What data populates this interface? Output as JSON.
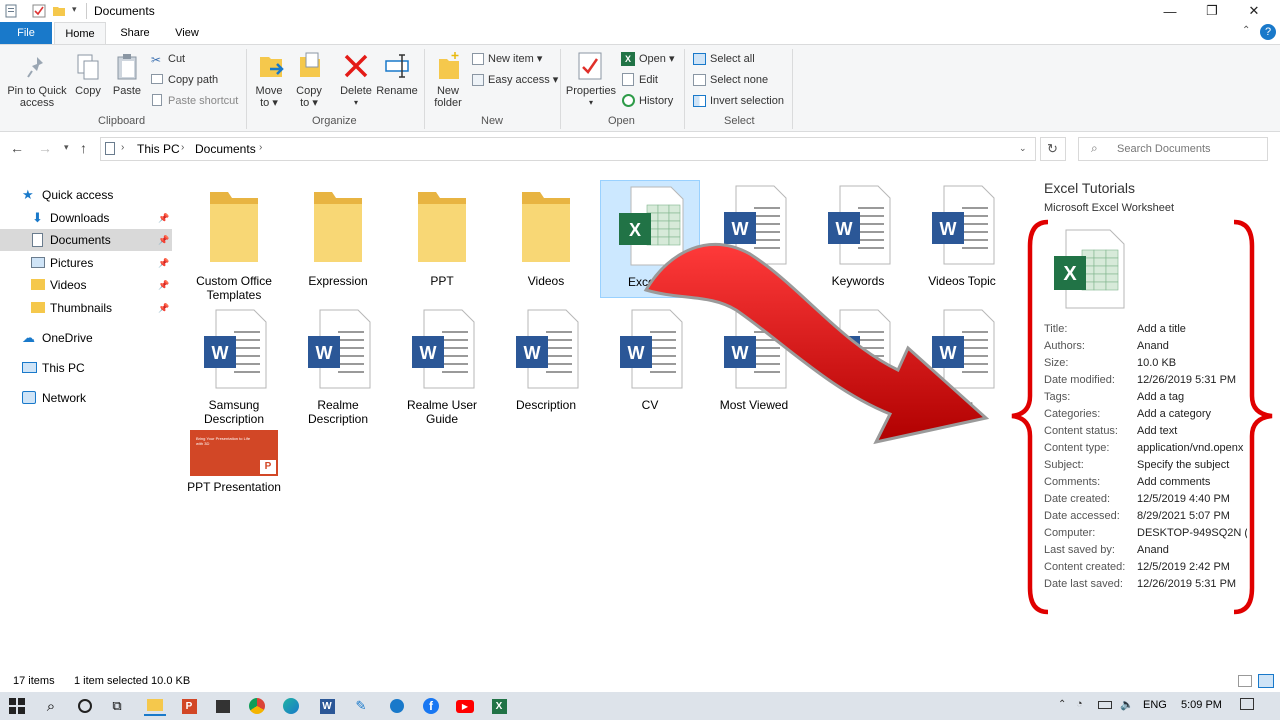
{
  "window": {
    "title": "Documents",
    "minimize": "—",
    "maximize": "❐",
    "close": "✕"
  },
  "tabs": {
    "file": "File",
    "home": "Home",
    "share": "Share",
    "view": "View"
  },
  "ribbon": {
    "clipboard": {
      "pin_l1": "Pin to Quick",
      "pin_l2": "access",
      "copy": "Copy",
      "paste": "Paste",
      "cut": "Cut",
      "copy_path": "Copy path",
      "paste_shortcut": "Paste shortcut",
      "label": "Clipboard"
    },
    "organize": {
      "move_l1": "Move",
      "move_l2": "to ▾",
      "copy_l1": "Copy",
      "copy_l2": "to ▾",
      "delete": "Delete",
      "delete_arrow": "▾",
      "rename": "Rename",
      "label": "Organize"
    },
    "new": {
      "new_folder_l1": "New",
      "new_folder_l2": "folder",
      "new_item": "New item ▾",
      "easy_access": "Easy access ▾",
      "label": "New"
    },
    "open": {
      "properties": "Properties",
      "properties_arrow": "▾",
      "open": "Open ▾",
      "edit": "Edit",
      "history": "History",
      "label": "Open"
    },
    "select": {
      "select_all": "Select all",
      "select_none": "Select none",
      "invert": "Invert selection",
      "label": "Select"
    }
  },
  "address": {
    "this_pc": "This PC",
    "documents": "Documents",
    "search_placeholder": "Search Documents"
  },
  "nav": {
    "quick_access": "Quick access",
    "downloads": "Downloads",
    "documents": "Documents",
    "pictures": "Pictures",
    "videos": "Videos",
    "thumbnails": "Thumbnails",
    "onedrive": "OneDrive",
    "this_pc": "This PC",
    "network": "Network"
  },
  "items": [
    {
      "type": "folder",
      "l1": "Custom Office",
      "l2": "Templates"
    },
    {
      "type": "folder",
      "l1": "Expression",
      "l2": ""
    },
    {
      "type": "folder",
      "l1": "PPT",
      "l2": ""
    },
    {
      "type": "folder",
      "l1": "Videos",
      "l2": ""
    },
    {
      "type": "excel",
      "l1": "Excel Tu",
      "l2": ""
    },
    {
      "type": "word",
      "l1": "pics",
      "l2": ""
    },
    {
      "type": "word",
      "l1": "Keywords",
      "l2": ""
    },
    {
      "type": "word",
      "l1": "Videos Topic",
      "l2": ""
    },
    {
      "type": "word",
      "l1": "Samsung",
      "l2": "Description"
    },
    {
      "type": "word",
      "l1": "Realme",
      "l2": "Description"
    },
    {
      "type": "word",
      "l1": "Realme User",
      "l2": "Guide"
    },
    {
      "type": "word",
      "l1": "Description",
      "l2": ""
    },
    {
      "type": "word",
      "l1": "CV",
      "l2": ""
    },
    {
      "type": "word",
      "l1": "Most Viewed",
      "l2": ""
    },
    {
      "type": "word",
      "l1": "",
      "l2": ""
    },
    {
      "type": "word",
      "l1": "cing",
      "l2": ""
    },
    {
      "type": "ppt",
      "l1": "PPT Presentation",
      "l2": ""
    }
  ],
  "ppt_thumb_text": "Bring Your Presentation to Life with 3D",
  "details": {
    "name": "Excel Tutorials",
    "type": "Microsoft Excel Worksheet",
    "props": [
      {
        "k": "Title:",
        "v": "Add a title"
      },
      {
        "k": "Authors:",
        "v": "Anand"
      },
      {
        "k": "Size:",
        "v": "10.0 KB"
      },
      {
        "k": "Date modified:",
        "v": "12/26/2019 5:31 PM"
      },
      {
        "k": "Tags:",
        "v": "Add a tag"
      },
      {
        "k": "Categories:",
        "v": "Add a category"
      },
      {
        "k": "Content status:",
        "v": "Add text"
      },
      {
        "k": "Content type:",
        "v": "application/vnd.openx"
      },
      {
        "k": "Subject:",
        "v": "Specify the subject"
      },
      {
        "k": "Comments:",
        "v": "Add comments"
      },
      {
        "k": "Date created:",
        "v": "12/5/2019 4:40 PM"
      },
      {
        "k": "Date accessed:",
        "v": "8/29/2021 5:07 PM"
      },
      {
        "k": "Computer:",
        "v": "DESKTOP-949SQ2N (t"
      },
      {
        "k": "Last saved by:",
        "v": "Anand"
      },
      {
        "k": "Content created:",
        "v": "12/5/2019 2:42 PM"
      },
      {
        "k": "Date last saved:",
        "v": "12/26/2019 5:31 PM"
      }
    ]
  },
  "status": {
    "count": "17 items",
    "selected": "1 item selected  10.0 KB"
  },
  "taskbar": {
    "lang": "ENG",
    "time": "5:09 PM"
  },
  "colors": {
    "accent": "#1979ca",
    "annotation_red": "#e00000",
    "folder": "#f5c84c",
    "word": "#2b5797",
    "excel": "#217346",
    "ppt": "#d24726"
  }
}
